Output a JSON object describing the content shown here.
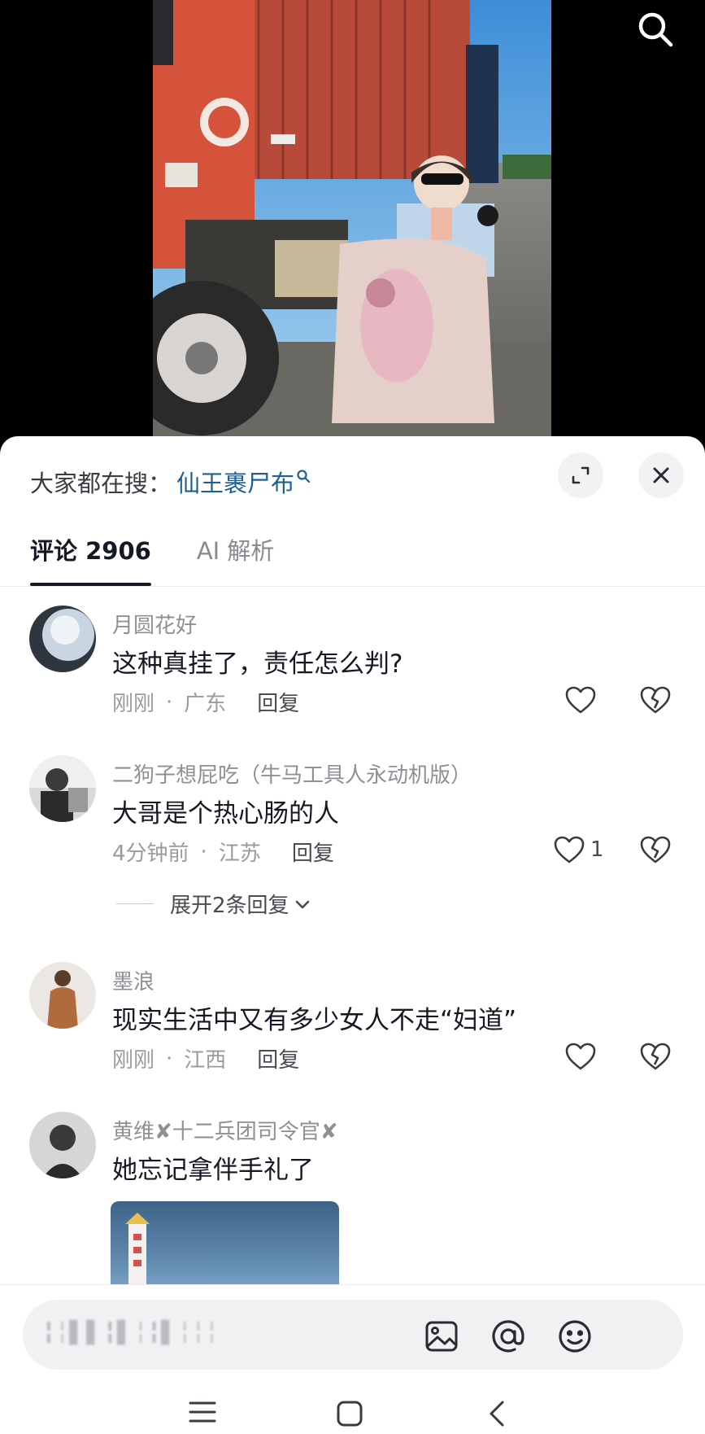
{
  "hot_search": {
    "label": "大家都在搜：",
    "keyword": "仙王裹尸布"
  },
  "tabs": [
    {
      "label": "评论 2906",
      "active": true
    },
    {
      "label": "AI 解析",
      "active": false
    }
  ],
  "comments": [
    {
      "user": "月圆花好",
      "text": "这种真挂了，责任怎么判?",
      "time": "刚刚",
      "location": "广东",
      "reply_label": "回复",
      "likes": ""
    },
    {
      "user": "二狗子想屁吃（牛马工具人永动机版）",
      "text": "大哥是个热心肠的人",
      "time": "4分钟前",
      "location": "江苏",
      "reply_label": "回复",
      "likes": "1",
      "expand_label": "展开2条回复"
    },
    {
      "user": "墨浪",
      "text": "现实生活中又有多少女人不走“妇道”",
      "time": "刚刚",
      "location": "江西",
      "reply_label": "回复",
      "likes": ""
    },
    {
      "user": "黄维✘十二兵团司令官✘",
      "text": "她忘记拿伴手礼了"
    }
  ],
  "input": {
    "placeholder_blurred": "╏╎▌▌╏▌╎╏▌╎╎╎"
  },
  "colors": {
    "accent_link": "#1e5f95",
    "text_primary": "#161823",
    "text_secondary": "#8f9096"
  },
  "icons": [
    "search-icon",
    "expand-icon",
    "close-icon",
    "heart-icon",
    "broken-heart-icon",
    "chevron-down-icon",
    "image-icon",
    "at-icon",
    "emoji-icon",
    "menu-icon",
    "home-square-icon",
    "back-icon"
  ]
}
